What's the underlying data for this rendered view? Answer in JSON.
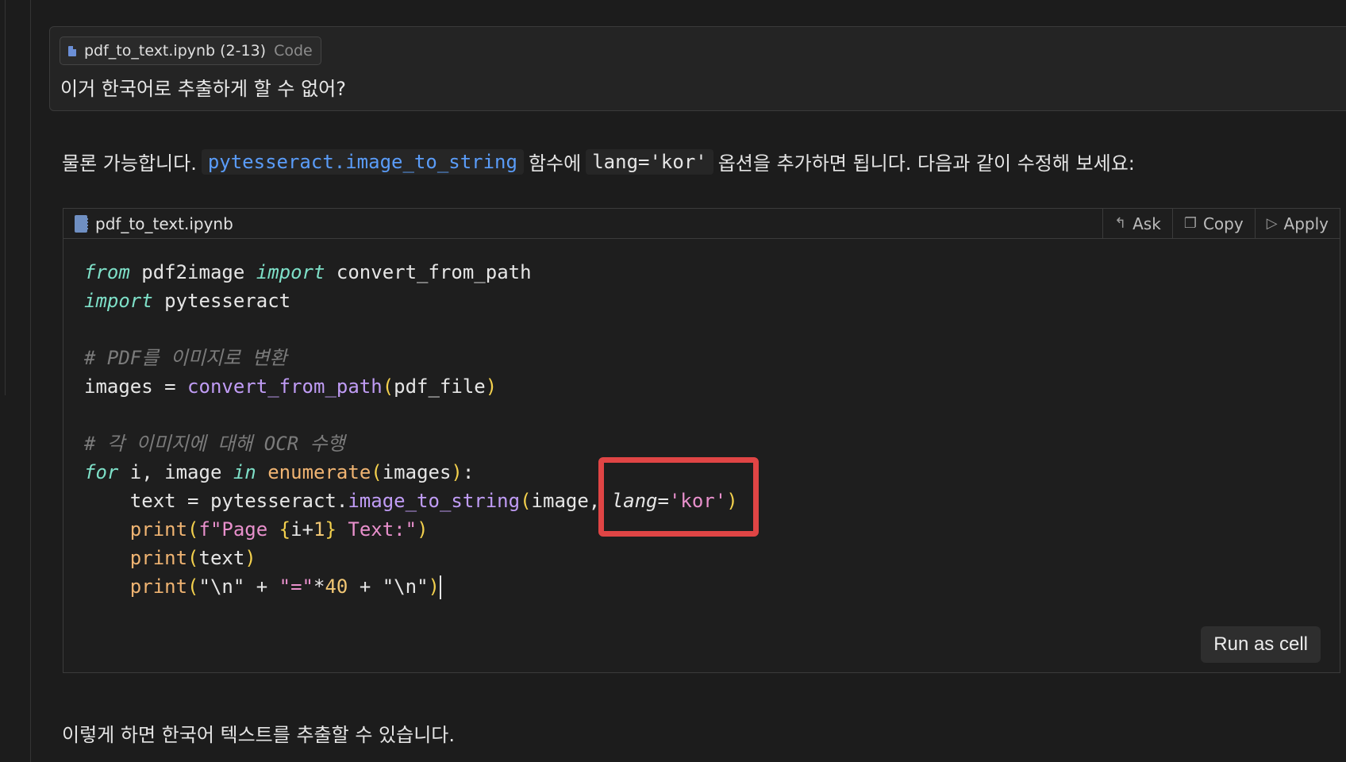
{
  "user_message": {
    "context_chip": {
      "filename": "pdf_to_text.ipynb (2-13)",
      "kind": "Code"
    },
    "text": "이거 한국어로 추출하게 할 수 없어?"
  },
  "answer": {
    "intro_before": "물론 가능합니다.",
    "code_func": "pytesseract.image_to_string",
    "intro_middle": "함수에",
    "code_opt": "lang='kor'",
    "intro_after": "옵션을 추가하면 됩니다. 다음과 같이 수정해 보세요:",
    "footer": "이렇게 하면 한국어 텍스트를 추출할 수 있습니다."
  },
  "code_block": {
    "filename": "pdf_to_text.ipynb",
    "actions": {
      "ask": "Ask",
      "copy": "Copy",
      "apply": "Apply"
    },
    "icons": {
      "ask": "reply-icon",
      "copy": "copy-icon",
      "apply": "play-icon",
      "file": "notebook-icon"
    },
    "run_label": "Run as cell",
    "highlight_color": "#e04545"
  }
}
